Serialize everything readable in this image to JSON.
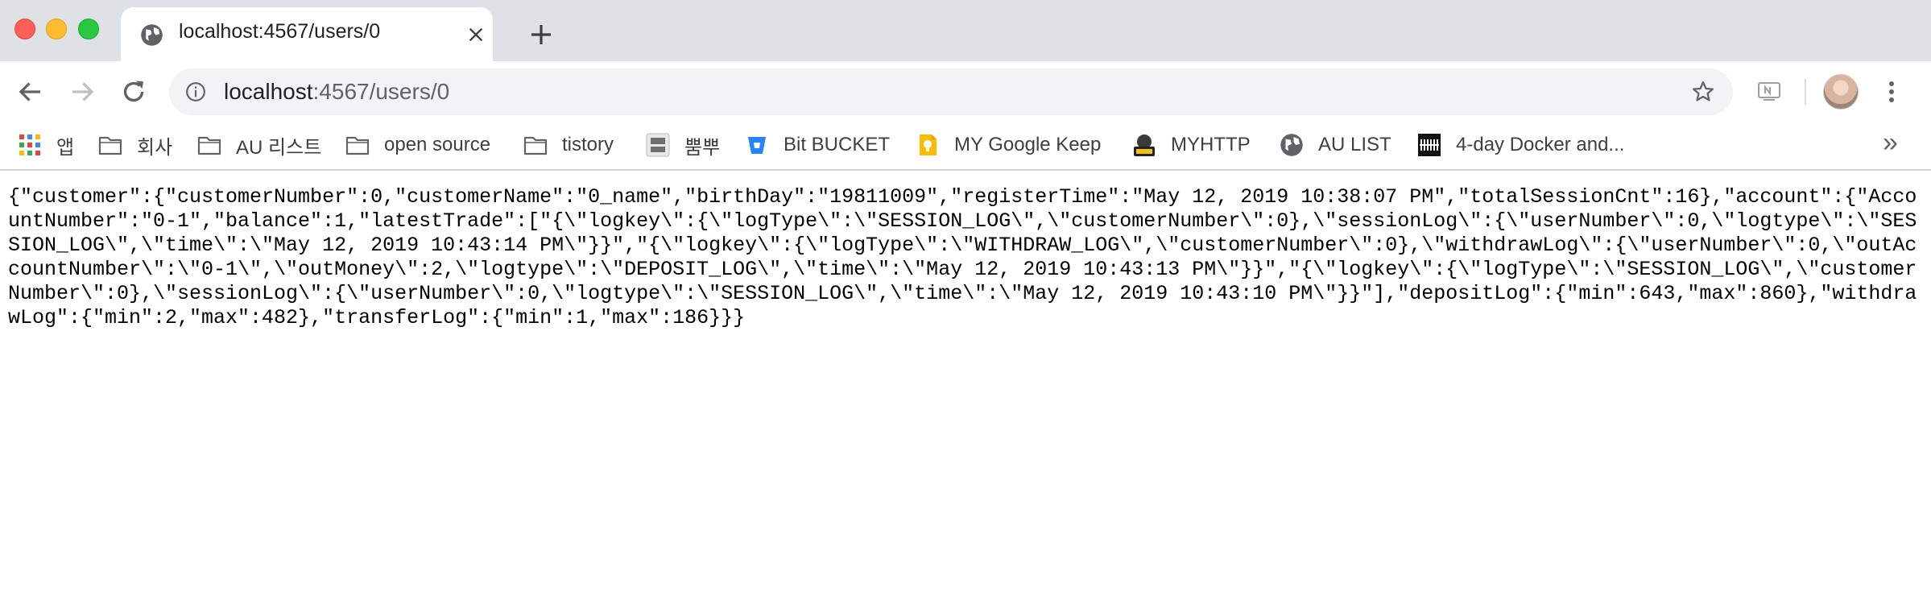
{
  "window": {
    "controls": [
      "close",
      "minimize",
      "maximize"
    ]
  },
  "tab": {
    "title": "localhost:4567/users/0",
    "favicon": "globe-icon"
  },
  "toolbar": {
    "url_host": "localhost",
    "url_rest": ":4567/users/0",
    "icons": [
      "back-arrow-icon",
      "forward-arrow-icon",
      "reload-icon",
      "info-icon",
      "star-icon",
      "extension-icon",
      "avatar",
      "menu-icon"
    ]
  },
  "bookmarks": {
    "items": [
      {
        "label": "앱",
        "icon": "apps-grid-icon"
      },
      {
        "label": "회사",
        "icon": "folder-icon"
      },
      {
        "label": "AU 리스트",
        "icon": "folder-icon"
      },
      {
        "label": "open source",
        "icon": "folder-icon"
      },
      {
        "label": "tistory",
        "icon": "folder-icon"
      },
      {
        "label": "뿜뿌",
        "icon": "ppomppu-icon"
      },
      {
        "label": "Bit BUCKET",
        "icon": "bitbucket-icon"
      },
      {
        "label": "MY Google Keep",
        "icon": "keep-icon"
      },
      {
        "label": "MYHTTP",
        "icon": "hfs-icon"
      },
      {
        "label": "AU LIST",
        "icon": "globe-icon"
      },
      {
        "label": "4-day Docker and...",
        "icon": "docker-course-icon"
      }
    ],
    "overflow": "»"
  },
  "page": {
    "body_text": "{\"customer\":{\"customerNumber\":0,\"customerName\":\"0_name\",\"birthDay\":\"19811009\",\"registerTime\":\"May 12, 2019 10:38:07 PM\",\"totalSessionCnt\":16},\"account\":{\"AccountNumber\":\"0-1\",\"balance\":1,\"latestTrade\":[\"{\\\"logkey\\\":{\\\"logType\\\":\\\"SESSION_LOG\\\",\\\"customerNumber\\\":0},\\\"sessionLog\\\":{\\\"userNumber\\\":0,\\\"logtype\\\":\\\"SESSION_LOG\\\",\\\"time\\\":\\\"May 12, 2019 10:43:14 PM\\\"}}\",\"{\\\"logkey\\\":{\\\"logType\\\":\\\"WITHDRAW_LOG\\\",\\\"customerNumber\\\":0},\\\"withdrawLog\\\":{\\\"userNumber\\\":0,\\\"outAccountNumber\\\":\\\"0-1\\\",\\\"outMoney\\\":2,\\\"logtype\\\":\\\"DEPOSIT_LOG\\\",\\\"time\\\":\\\"May 12, 2019 10:43:13 PM\\\"}}\",\"{\\\"logkey\\\":{\\\"logType\\\":\\\"SESSION_LOG\\\",\\\"customerNumber\\\":0},\\\"sessionLog\\\":{\\\"userNumber\\\":0,\\\"logtype\\\":\\\"SESSION_LOG\\\",\\\"time\\\":\\\"May 12, 2019 10:43:10 PM\\\"}}\"],\"depositLog\":{\"min\":643,\"max\":860},\"withdrawLog\":{\"min\":2,\"max\":482},\"transferLog\":{\"min\":1,\"max\":186}}}"
  }
}
